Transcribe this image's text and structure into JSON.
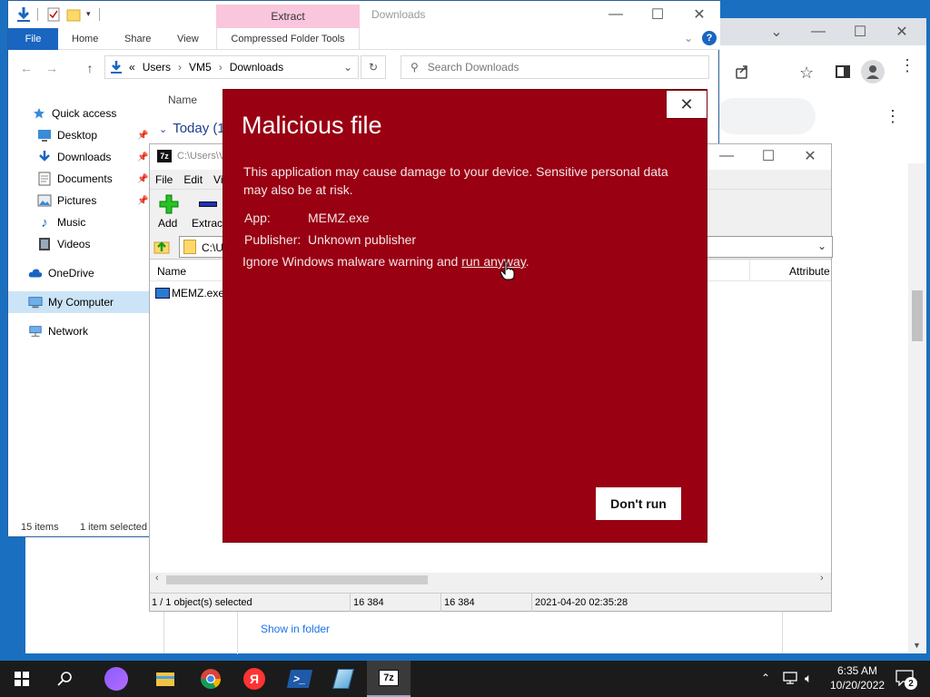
{
  "explorer": {
    "title": "Downloads",
    "contextual_tab": "Extract",
    "tabs": [
      "File",
      "Home",
      "Share",
      "View",
      "Compressed Folder Tools"
    ],
    "address": {
      "seg1": "Users",
      "seg2": "VM5",
      "seg3": "Downloads",
      "prefix": "«"
    },
    "search_placeholder": "Search Downloads",
    "column_name": "Name",
    "group_today": "Today (1",
    "sidebar": {
      "quick_access": "Quick access",
      "items": [
        "Desktop",
        "Downloads",
        "Documents",
        "Pictures",
        "Music",
        "Videos"
      ],
      "onedrive": "OneDrive",
      "my_computer": "My Computer",
      "network": "Network"
    },
    "status_count": "15 items",
    "status_selected": "1 item selected"
  },
  "sevenzip": {
    "title": "C:\\Users\\V",
    "menu": [
      "File",
      "Edit",
      "Vi"
    ],
    "tool_add": "Add",
    "tool_extract": "Extract",
    "path": "C:\\U",
    "col_name": "Name",
    "col_attributes": "Attribute",
    "file_name": "MEMZ.exe",
    "status_selected": "1 / 1 object(s) selected",
    "status_size": "16 384",
    "status_packed": "16 384",
    "status_date": "2021-04-20 02:35:28"
  },
  "chrome": {
    "show_in_folder": "Show in folder"
  },
  "dialog": {
    "title": "Malicious file",
    "message": "This application may cause damage to your device. Sensitive personal data may also be at risk.",
    "app_label": "App:",
    "app_value": "MEMZ.exe",
    "publisher_label": "Publisher:",
    "publisher_value": "Unknown publisher",
    "ignore_text": "Ignore Windows malware warning and ",
    "run_link": "run anyway",
    "period": ".",
    "button": "Don't run"
  },
  "taskbar": {
    "time": "6:35 AM",
    "date": "10/20/2022",
    "notif_count": "2"
  },
  "colors": {
    "dialog_bg": "#990012",
    "explorer_file_tab": "#1a65c0",
    "extract_tab": "#f9c6dd"
  }
}
